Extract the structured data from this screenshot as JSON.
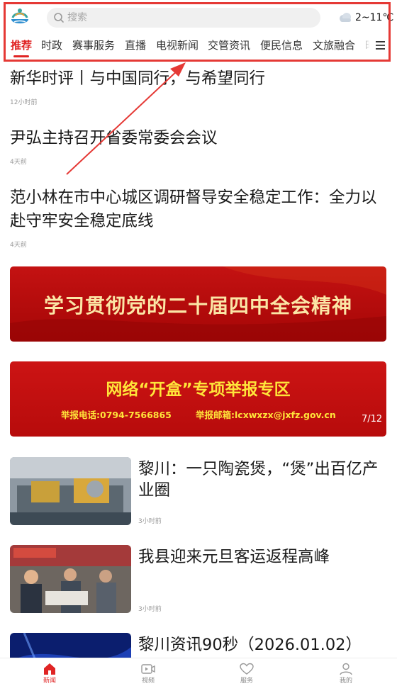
{
  "header": {
    "search_placeholder": "搜索",
    "weather_temp": "2~11℃"
  },
  "tabs": [
    {
      "label": "推荐",
      "active": true
    },
    {
      "label": "时政"
    },
    {
      "label": "赛事服务"
    },
    {
      "label": "直播"
    },
    {
      "label": "电视新闻"
    },
    {
      "label": "交管资讯"
    },
    {
      "label": "便民信息"
    },
    {
      "label": "文旅融合"
    },
    {
      "label": "时"
    }
  ],
  "text_articles": [
    {
      "title": "新华时评丨与中国同行，与希望同行",
      "time": "12小时前"
    },
    {
      "title": "尹弘主持召开省委常委会会议",
      "time": "4天前"
    },
    {
      "title": "范小林在市中心城区调研督导安全稳定工作：全力以赴守牢安全稳定底线",
      "time": "4天前"
    }
  ],
  "banners": [
    {
      "text": "学习贯彻党的二十届四中全会精神"
    },
    {
      "text": "网络“开盒”专项举报专区",
      "phone": "举报电话:0794-7566865",
      "email": "举报邮箱:lcxwxzx@jxfz.gov.cn",
      "counter": "7/12"
    }
  ],
  "image_articles": [
    {
      "title": "黎川：一只陶瓷煲，“煲”出百亿产业圈",
      "time": "3小时前"
    },
    {
      "title": "我县迎来元旦客运返程高峰",
      "time": "3小时前"
    },
    {
      "title": "黎川资讯90秒（2026.01.02）",
      "time": ""
    }
  ],
  "bottom_nav": [
    {
      "label": "新闻",
      "icon": "home-icon",
      "active": true
    },
    {
      "label": "视频",
      "icon": "video-icon"
    },
    {
      "label": "服务",
      "icon": "heart-icon"
    },
    {
      "label": "我的",
      "icon": "user-icon"
    }
  ],
  "colors": {
    "accent": "#e02424",
    "annotation": "#e53935"
  }
}
